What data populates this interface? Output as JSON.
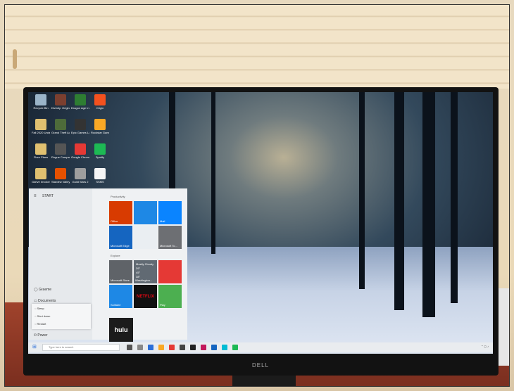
{
  "start_menu": {
    "title": "START",
    "user": "Graeme",
    "documents": "Documents",
    "power_label": "Power",
    "power_options": [
      "Sleep",
      "Shut down",
      "Restart"
    ],
    "sections": [
      "Productivity",
      "Explore"
    ]
  },
  "tiles": [
    {
      "id": "office",
      "label": "Office",
      "color": "#d83b01"
    },
    {
      "id": "photos",
      "label": "",
      "color": "#1e88e5"
    },
    {
      "id": "mail",
      "label": "Mail",
      "color": "#0a84ff"
    },
    {
      "id": "edge",
      "label": "Microsoft Edge",
      "color": "#1565c0"
    },
    {
      "id": "todo",
      "label": "",
      "color": "#eaeef2"
    },
    {
      "id": "msto",
      "label": "Microsoft To...",
      "color": "#6d6f73"
    },
    {
      "id": "store",
      "label": "Microsoft Store",
      "color": "#5f6368"
    },
    {
      "id": "weather",
      "label": "Washington...",
      "color": "#616a73"
    },
    {
      "id": "news",
      "label": "",
      "color": "#e53935"
    },
    {
      "id": "solitaire",
      "label": "Solitaire",
      "color": "#1e88e5"
    },
    {
      "id": "netflix",
      "label": "NETFLIX",
      "color": "#111111"
    },
    {
      "id": "play",
      "label": "Play",
      "color": "#4caf50"
    }
  ],
  "weather": {
    "condition": "Mostly Cloudy",
    "temp": "39°",
    "hi": "45°",
    "lo": "38°"
  },
  "hulu_label": "hulu",
  "desktop_icons": [
    {
      "label": "Recycle Bin",
      "color": "#9bb4c8"
    },
    {
      "label": "Divinity: Original Sin 2",
      "color": "#7b3f2f"
    },
    {
      "label": "Dragon Age Inquisition",
      "color": "#2e7d32"
    },
    {
      "label": "Origin",
      "color": "#f4511e"
    },
    {
      "label": "Fall 2020 Undergr...",
      "color": "#e0c070"
    },
    {
      "label": "Grand Theft Auto V",
      "color": "#4e6b3a"
    },
    {
      "label": "Epic Games Launcher",
      "color": "#333333"
    },
    {
      "label": "Rockstar Games...",
      "color": "#f9a825"
    },
    {
      "label": "Floor Plans",
      "color": "#e0c070"
    },
    {
      "label": "Rogue Company",
      "color": "#555555"
    },
    {
      "label": "Google Chrome",
      "color": "#e53935"
    },
    {
      "label": "Spotify",
      "color": "#1db954"
    },
    {
      "label": "Gdrive Invoices",
      "color": "#e0c070"
    },
    {
      "label": "Stardew Valley",
      "color": "#e65100"
    },
    {
      "label": "Guild Wars 2",
      "color": "#9e9e9e"
    },
    {
      "label": "SSMS",
      "color": "#f5f5f5"
    }
  ],
  "taskbar": {
    "search_placeholder": "Type here to search",
    "tray_time": "",
    "tray_date": ""
  },
  "monitor_brand": "DELL"
}
